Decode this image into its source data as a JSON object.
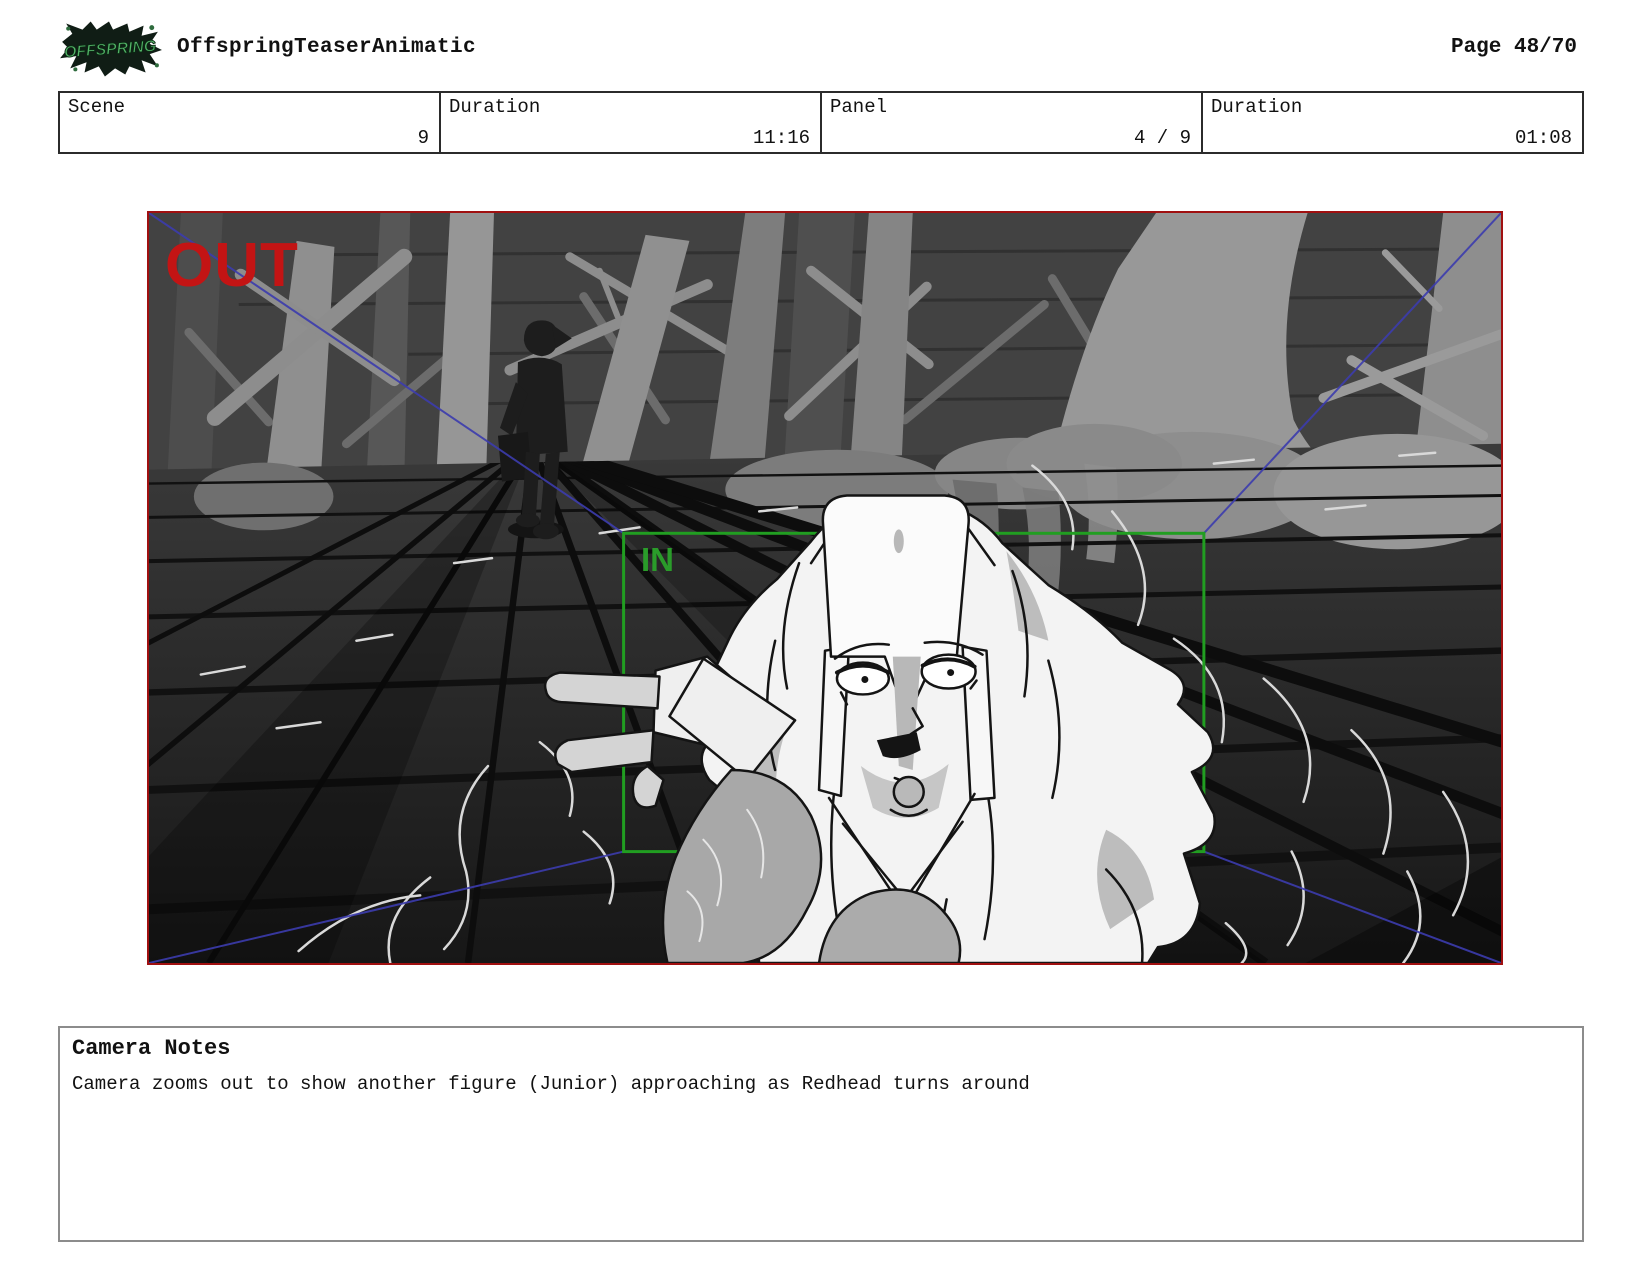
{
  "header": {
    "logo_text": "OFFSPRING",
    "title": "OffspringTeaserAnimatic",
    "page_label": "Page 48/70"
  },
  "info_table": {
    "cells": [
      {
        "label": "Scene",
        "value": "9"
      },
      {
        "label": "Duration",
        "value": "11:16"
      },
      {
        "label": "Panel",
        "value": "4 / 9"
      },
      {
        "label": "Duration",
        "value": "01:08"
      }
    ]
  },
  "storyboard_panel": {
    "out_label": "OUT",
    "in_label": "IN",
    "colors": {
      "panel_border": "#a01010",
      "out_text": "#c31414",
      "in_frame": "#219e21",
      "zoom_guides": "#3c3cae",
      "logo_green": "#54b568"
    }
  },
  "camera_notes": {
    "title": "Camera Notes",
    "body": "Camera zooms out to show another figure (Junior) approaching as Redhead turns around"
  }
}
